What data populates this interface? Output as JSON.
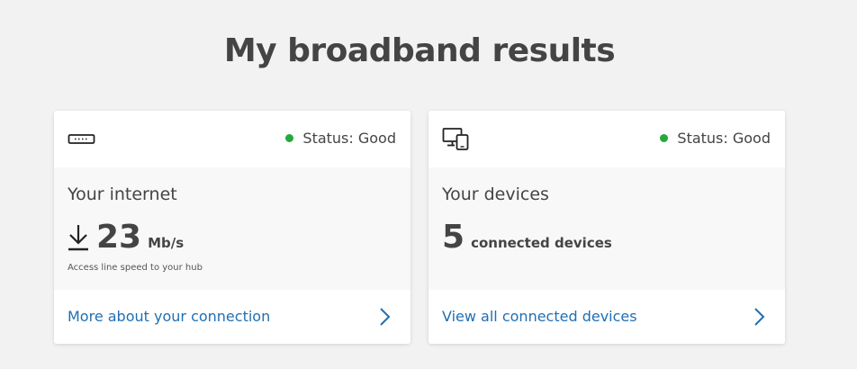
{
  "page": {
    "title": "My broadband results"
  },
  "colors": {
    "status_good": "#22aa3d",
    "link": "#1f6fb4"
  },
  "cards": {
    "internet": {
      "icon": "router-icon",
      "status": "Status: Good",
      "title": "Your internet",
      "value": "23",
      "unit": "Mb/s",
      "caption": "Access line speed to your hub",
      "link": "More about your connection"
    },
    "devices": {
      "icon": "devices-icon",
      "status": "Status: Good",
      "title": "Your devices",
      "value": "5",
      "unit": "connected devices",
      "link": "View all connected devices"
    }
  }
}
